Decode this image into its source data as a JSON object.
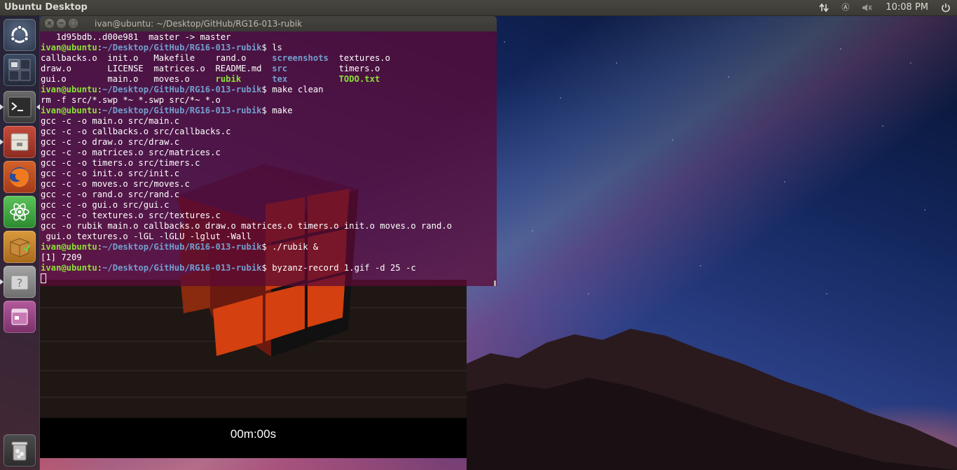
{
  "top_panel": {
    "title": "Ubuntu Desktop",
    "clock": "10:08 PM",
    "indicators": [
      "network-icon",
      "keyboard-icon",
      "volume-icon",
      "clock",
      "power-icon"
    ]
  },
  "launcher": {
    "items": [
      {
        "name": "dash-home",
        "icon": "ubuntu-logo-icon",
        "running": false
      },
      {
        "name": "workspace-switcher",
        "icon": "workspace-switcher-icon",
        "running": false
      },
      {
        "name": "terminal",
        "icon": "terminal-icon",
        "running": true,
        "focused": true
      },
      {
        "name": "files",
        "icon": "file-cabinet-icon",
        "running": true
      },
      {
        "name": "firefox",
        "icon": "firefox-icon",
        "running": false
      },
      {
        "name": "atom",
        "icon": "atom-icon",
        "running": false
      },
      {
        "name": "software-center",
        "icon": "package-icon",
        "running": false
      },
      {
        "name": "unknown-app",
        "icon": "question-mark-icon",
        "running": true
      },
      {
        "name": "rubik-app",
        "icon": "generic-window-icon",
        "running": false
      },
      {
        "name": "trash",
        "icon": "trash-icon",
        "running": false
      }
    ]
  },
  "terminal": {
    "title": "ivan@ubuntu: ~/Desktop/GitHub/RG16-013-rubik",
    "lines": [
      [
        {
          "t": "   1d95bdb..d00e981  master -> master",
          "c": "plain"
        }
      ],
      [
        {
          "t": "ivan@ubuntu",
          "c": "user"
        },
        {
          "t": ":",
          "c": "plain"
        },
        {
          "t": "~/Desktop/GitHub/RG16-013-rubik",
          "c": "path"
        },
        {
          "t": "$ ls",
          "c": "plain"
        }
      ],
      [
        {
          "t": "callbacks.o  init.o   Makefile    rand.o     ",
          "c": "plain"
        },
        {
          "t": "screenshots",
          "c": "dir"
        },
        {
          "t": "  textures.o",
          "c": "plain"
        }
      ],
      [
        {
          "t": "draw.o       LICENSE  matrices.o  README.md  ",
          "c": "plain"
        },
        {
          "t": "src",
          "c": "dir"
        },
        {
          "t": "          timers.o",
          "c": "plain"
        }
      ],
      [
        {
          "t": "gui.o        main.o   moves.o     ",
          "c": "plain"
        },
        {
          "t": "rubik",
          "c": "exec"
        },
        {
          "t": "      ",
          "c": "plain"
        },
        {
          "t": "tex",
          "c": "dir"
        },
        {
          "t": "          ",
          "c": "plain"
        },
        {
          "t": "TODO.txt",
          "c": "exec"
        }
      ],
      [
        {
          "t": "ivan@ubuntu",
          "c": "user"
        },
        {
          "t": ":",
          "c": "plain"
        },
        {
          "t": "~/Desktop/GitHub/RG16-013-rubik",
          "c": "path"
        },
        {
          "t": "$ make clean",
          "c": "plain"
        }
      ],
      [
        {
          "t": "rm -f src/*.swp *~ *.swp src/*~ *.o",
          "c": "plain"
        }
      ],
      [
        {
          "t": "ivan@ubuntu",
          "c": "user"
        },
        {
          "t": ":",
          "c": "plain"
        },
        {
          "t": "~/Desktop/GitHub/RG16-013-rubik",
          "c": "path"
        },
        {
          "t": "$ make",
          "c": "plain"
        }
      ],
      [
        {
          "t": "gcc -c -o main.o src/main.c",
          "c": "plain"
        }
      ],
      [
        {
          "t": "gcc -c -o callbacks.o src/callbacks.c",
          "c": "plain"
        }
      ],
      [
        {
          "t": "gcc -c -o draw.o src/draw.c",
          "c": "plain"
        }
      ],
      [
        {
          "t": "gcc -c -o matrices.o src/matrices.c",
          "c": "plain"
        }
      ],
      [
        {
          "t": "gcc -c -o timers.o src/timers.c",
          "c": "plain"
        }
      ],
      [
        {
          "t": "gcc -c -o init.o src/init.c",
          "c": "plain"
        }
      ],
      [
        {
          "t": "gcc -c -o moves.o src/moves.c",
          "c": "plain"
        }
      ],
      [
        {
          "t": "gcc -c -o rand.o src/rand.c",
          "c": "plain"
        }
      ],
      [
        {
          "t": "gcc -c -o gui.o src/gui.c",
          "c": "plain"
        }
      ],
      [
        {
          "t": "gcc -c -o textures.o src/textures.c",
          "c": "plain"
        }
      ],
      [
        {
          "t": "gcc -o rubik main.o callbacks.o draw.o matrices.o timers.o init.o moves.o rand.o",
          "c": "plain"
        }
      ],
      [
        {
          "t": " gui.o textures.o -lGL -lGLU -lglut -Wall",
          "c": "plain"
        }
      ],
      [
        {
          "t": "ivan@ubuntu",
          "c": "user"
        },
        {
          "t": ":",
          "c": "plain"
        },
        {
          "t": "~/Desktop/GitHub/RG16-013-rubik",
          "c": "path"
        },
        {
          "t": "$ ./rubik &",
          "c": "plain"
        }
      ],
      [
        {
          "t": "[1] 7209",
          "c": "plain"
        }
      ],
      [
        {
          "t": "ivan@ubuntu",
          "c": "user"
        },
        {
          "t": ":",
          "c": "plain"
        },
        {
          "t": "~/Desktop/GitHub/RG16-013-rubik",
          "c": "path"
        },
        {
          "t": "$ byzanz-record 1.gif -d 25 -c",
          "c": "plain"
        }
      ],
      []
    ]
  },
  "rubik_app": {
    "timer": "00m:00s"
  },
  "colors": {
    "terminal_bg": "#5c0a34",
    "prompt_user": "#8ae234",
    "prompt_path": "#729fcf",
    "cube_orange": "#d4400f",
    "panel_bg": "#3c3b37"
  }
}
